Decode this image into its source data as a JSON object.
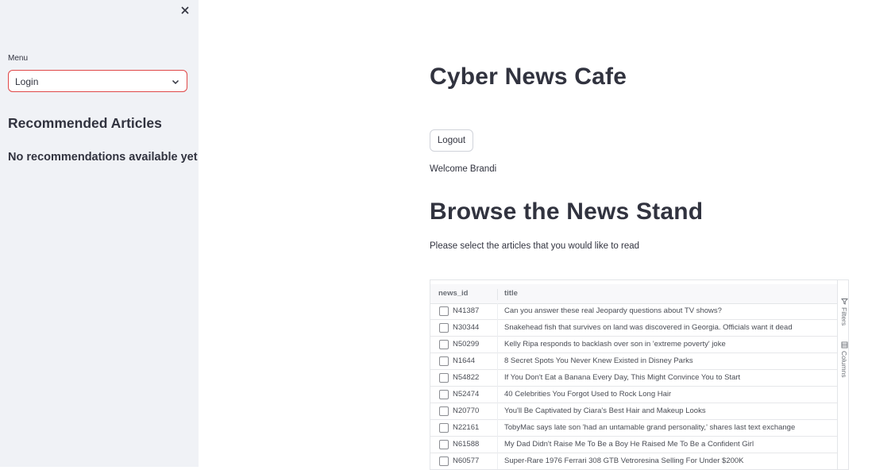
{
  "sidebar": {
    "menu_label": "Menu",
    "menu_value": "Login",
    "recommended_heading": "Recommended Articles",
    "no_recommendations": "No recommendations available yet"
  },
  "main": {
    "title": "Cyber News Cafe",
    "logout_label": "Logout",
    "welcome": "Welcome Brandi",
    "browse_heading": "Browse the News Stand",
    "instructions": "Please select the articles that you would like to read"
  },
  "grid": {
    "columns": [
      "news_id",
      "title"
    ],
    "side_tabs": [
      "Filters",
      "Columns"
    ],
    "rows": [
      {
        "news_id": "N41387",
        "title": "Can you answer these real Jeopardy questions about TV shows?"
      },
      {
        "news_id": "N30344",
        "title": "Snakehead fish that survives on land was discovered in Georgia. Officials want it dead"
      },
      {
        "news_id": "N50299",
        "title": "Kelly Ripa responds to backlash over son in 'extreme poverty' joke"
      },
      {
        "news_id": "N1644",
        "title": "8 Secret Spots You Never Knew Existed in Disney Parks"
      },
      {
        "news_id": "N54822",
        "title": "If You Don't Eat a Banana Every Day, This Might Convince You to Start"
      },
      {
        "news_id": "N52474",
        "title": "40 Celebrities You Forgot Used to Rock Long Hair"
      },
      {
        "news_id": "N20770",
        "title": "You'll Be Captivated by Ciara's Best Hair and Makeup Looks"
      },
      {
        "news_id": "N22161",
        "title": "TobyMac says late son 'had an untamable grand personality,' shares last text exchange"
      },
      {
        "news_id": "N61588",
        "title": "My Dad Didn't Raise Me To Be a Boy He Raised Me To Be a Confident Girl"
      },
      {
        "news_id": "N60577",
        "title": "Super-Rare 1976 Ferrari 308 GTB Vetroresina Selling For Under $200K"
      }
    ]
  },
  "colors": {
    "sidebar_bg": "#f0f2f6",
    "select_border": "#e04848",
    "text": "#31333f"
  }
}
